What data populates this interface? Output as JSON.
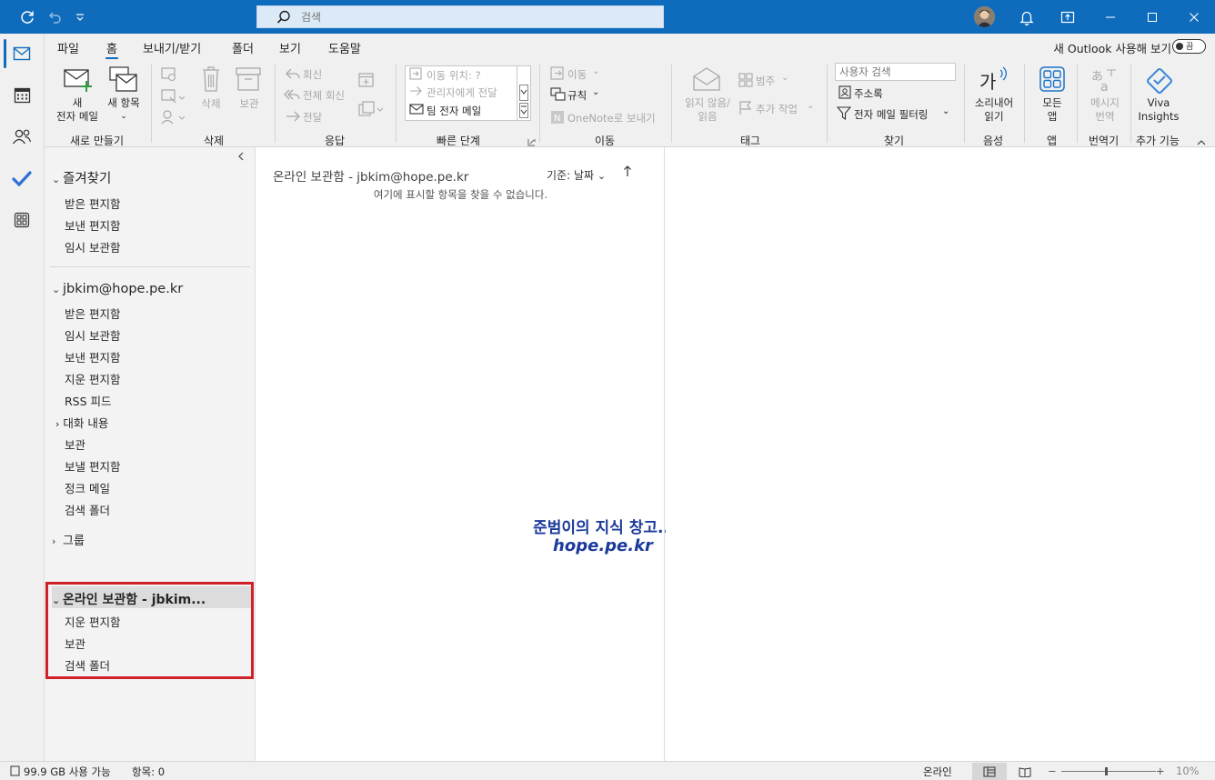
{
  "titlebar": {
    "search_placeholder": "검색",
    "icons": [
      "sync-icon",
      "undo-icon",
      "customize-qat-icon",
      "search-icon",
      "bell-icon",
      "feedback-icon",
      "minimize-icon",
      "maximize-icon",
      "close-icon"
    ]
  },
  "rail": {
    "items": [
      "mail-icon",
      "calendar-icon",
      "people-icon",
      "todo-icon",
      "apps-icon"
    ],
    "active": "mail-icon"
  },
  "menu": {
    "tabs": [
      "파일",
      "홈",
      "보내기/받기",
      "폴더",
      "보기",
      "도움말"
    ],
    "active_tab": "홈",
    "try_new": "새 Outlook 사용해 보기",
    "toggle_label": "끔"
  },
  "ribbon": {
    "new_group": {
      "new_mail_l1": "새",
      "new_mail_l2": "전자 메일",
      "new_items": "새 항목",
      "label": "새로 만들기"
    },
    "delete_group": {
      "delete": "삭제",
      "archive": "보관",
      "label": "삭제"
    },
    "respond_group": {
      "reply": "회신",
      "reply_all": "전체 회신",
      "forward": "전달",
      "label": "응답"
    },
    "quick_steps": {
      "items": [
        "이동 위치: ?",
        "관리자에게 전달",
        "팀 전자 메일"
      ],
      "label": "빠른 단계"
    },
    "move_group": {
      "move": "이동",
      "rules": "규칙",
      "onenote": "OneNote로 보내기",
      "label": "이동"
    },
    "tags_group": {
      "unread_l1": "읽지 않음/",
      "unread_l2": "읽음",
      "categorize": "범주",
      "follow_up": "추가 작업",
      "label": "태그"
    },
    "find_group": {
      "search_people": "사용자 검색",
      "address_book": "주소록",
      "filter_email": "전자 메일 필터링",
      "label": "찾기"
    },
    "speech_group": {
      "read_aloud_l1": "소리내어",
      "read_aloud_l2": "읽기",
      "label": "음성"
    },
    "apps_group": {
      "all_apps_l1": "모든",
      "all_apps_l2": "앱",
      "label": "앱"
    },
    "translator_group": {
      "translate_l1": "메시지",
      "translate_l2": "번역",
      "label": "번역기"
    },
    "addins_group": {
      "viva_l1": "Viva",
      "viva_l2": "Insights",
      "label": "추가 기능"
    }
  },
  "folders": {
    "favorites": {
      "title": "즐겨찾기",
      "items": [
        "받은 편지함",
        "보낸 편지함",
        "임시 보관함"
      ]
    },
    "account": {
      "title": "jbkim@hope.pe.kr",
      "items": [
        "받은 편지함",
        "임시 보관함",
        "보낸 편지함",
        "지운 편지함",
        "RSS 피드",
        "대화 내용",
        "보관",
        "보낼 편지함",
        "정크 메일",
        "검색 폴더"
      ]
    },
    "groups": {
      "title": "그룹"
    },
    "online_archive": {
      "title": "온라인 보관함 - jbkim...",
      "items": [
        "지운 편지함",
        "보관",
        "검색 폴더"
      ]
    }
  },
  "message_list": {
    "title": "온라인 보관함 - jbkim@hope.pe.kr",
    "sort_label": "기준: 날짜",
    "empty_text": "여기에 표시할 항목을 찾을 수 없습니다.",
    "watermark_line1": "준범이의 지식 창고..",
    "watermark_line2": "hope.pe.kr"
  },
  "status": {
    "storage": "99.9 GB 사용 가능",
    "items": "항목: 0",
    "connection": "온라인",
    "zoom": "10%"
  },
  "colors": {
    "accent": "#0f6cbd",
    "highlight_border": "#d0202a",
    "watermark": "#1b3a9a"
  }
}
